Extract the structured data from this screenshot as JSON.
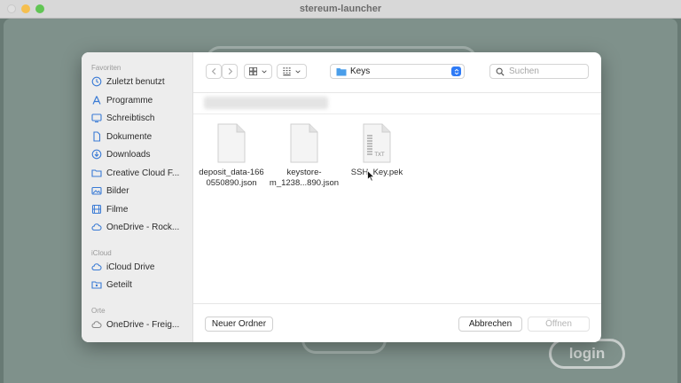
{
  "window": {
    "title": "stereum-launcher"
  },
  "app": {
    "login_label": "login"
  },
  "dialog": {
    "sidebar": {
      "favorites_title": "Favoriten",
      "favorites": [
        {
          "label": "Zuletzt benutzt",
          "icon": "clock-icon"
        },
        {
          "label": "Programme",
          "icon": "applications-icon"
        },
        {
          "label": "Schreibtisch",
          "icon": "desktop-icon"
        },
        {
          "label": "Dokumente",
          "icon": "document-icon"
        },
        {
          "label": "Downloads",
          "icon": "download-icon"
        },
        {
          "label": "Creative Cloud F...",
          "icon": "folder-icon"
        },
        {
          "label": "Bilder",
          "icon": "photos-icon"
        },
        {
          "label": "Filme",
          "icon": "film-icon"
        },
        {
          "label": "OneDrive - Rock...",
          "icon": "cloud-icon"
        }
      ],
      "icloud_title": "iCloud",
      "icloud": [
        {
          "label": "iCloud Drive",
          "icon": "cloud-icon"
        },
        {
          "label": "Geteilt",
          "icon": "shared-folder-icon"
        }
      ],
      "orte_title": "Orte",
      "orte": [
        {
          "label": "OneDrive - Freig...",
          "icon": "cloud-icon"
        }
      ]
    },
    "toolbar": {
      "current_folder": "Keys",
      "search_placeholder": "Suchen"
    },
    "files": [
      {
        "line1": "deposit_data-166",
        "line2": "0550890.json",
        "icon": "generic-file-icon"
      },
      {
        "line1": "keystore-",
        "line2": "m_1238...890.json",
        "icon": "generic-file-icon"
      },
      {
        "line1": "SSH_Key.pek",
        "line2": "",
        "icon": "text-file-icon",
        "badge": "TXT"
      }
    ],
    "buttons": {
      "new_folder": "Neuer Ordner",
      "cancel": "Abbrechen",
      "open": "Öffnen"
    }
  },
  "colors": {
    "accent": "#2f7bf6",
    "app_background": "#7f918b"
  }
}
